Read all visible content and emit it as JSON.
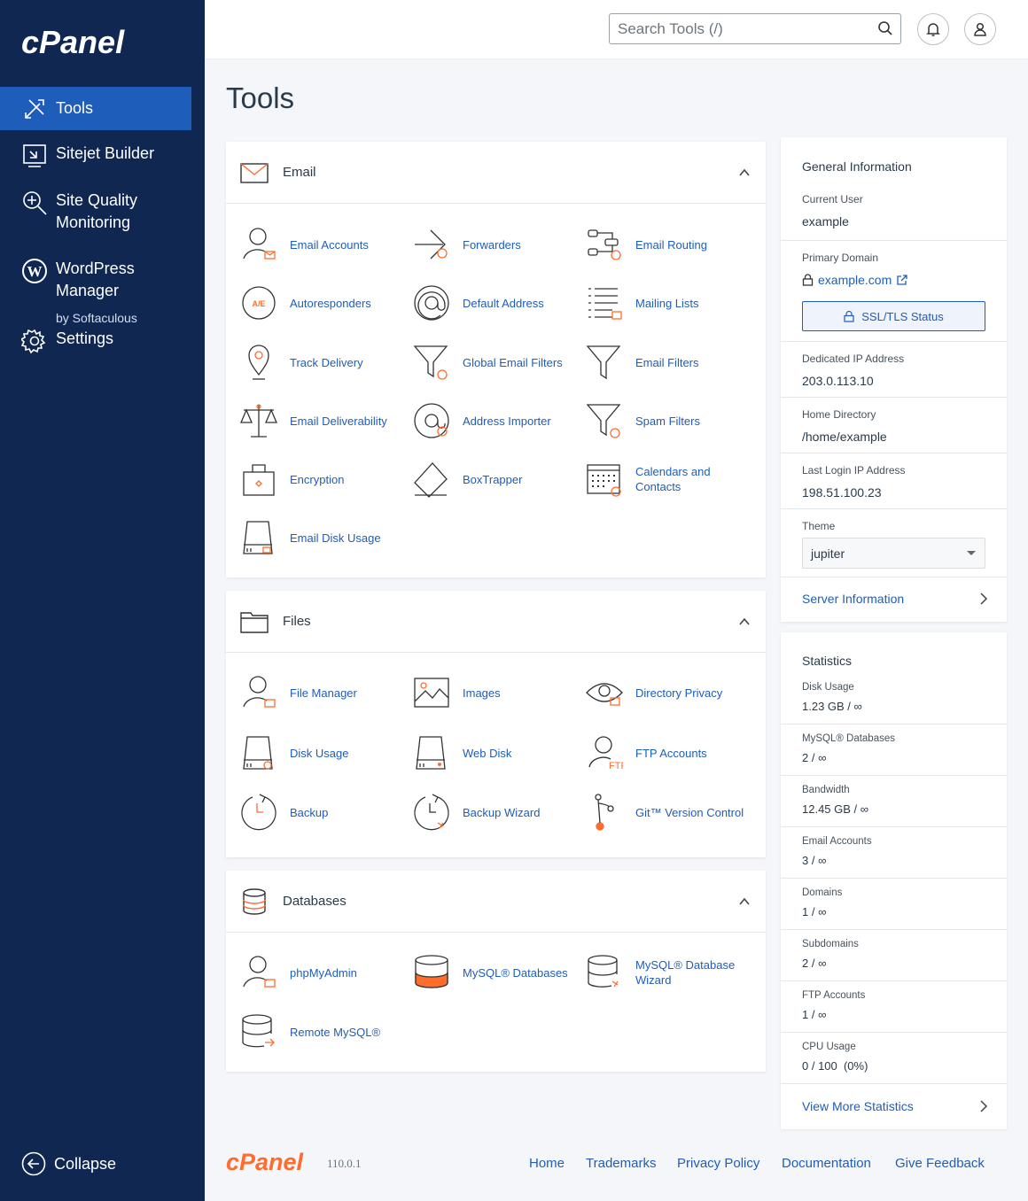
{
  "brand": {
    "logo_text": "cPanel",
    "orange": "#ff6c2c",
    "navy": "#0f2751",
    "blue": "#1f5dba"
  },
  "sidebar": {
    "items": [
      {
        "label": "Tools",
        "icon": "tools-icon",
        "active": true
      },
      {
        "label": "Sitejet Builder",
        "icon": "sitejet-icon"
      },
      {
        "label": "Site Quality Monitoring",
        "icon": "search-plus-icon"
      },
      {
        "label": "WordPress Manager",
        "sub": "by Softaculous",
        "icon": "wordpress-icon"
      },
      {
        "label": "Settings",
        "icon": "gear-icon"
      }
    ],
    "collapse": "Collapse"
  },
  "topbar": {
    "search_placeholder": "Search Tools (/)"
  },
  "page_title": "Tools",
  "sections": {
    "email": {
      "title": "Email",
      "items": [
        "Email Accounts",
        "Forwarders",
        "Email Routing",
        "Autoresponders",
        "Default Address",
        "Mailing Lists",
        "Track Delivery",
        "Global Email Filters",
        "Email Filters",
        "Email Deliverability",
        "Address Importer",
        "Spam Filters",
        "Encryption",
        "BoxTrapper",
        "Calendars and Contacts",
        "Email Disk Usage"
      ]
    },
    "files": {
      "title": "Files",
      "items": [
        "File Manager",
        "Images",
        "Directory Privacy",
        "Disk Usage",
        "Web Disk",
        "FTP Accounts",
        "Backup",
        "Backup Wizard",
        "Git™ Version Control"
      ]
    },
    "databases": {
      "title": "Databases",
      "items": [
        "phpMyAdmin",
        "MySQL® Databases",
        "MySQL® Database Wizard",
        "Remote MySQL®"
      ]
    }
  },
  "general": {
    "title": "General Information",
    "current_user_label": "Current User",
    "current_user": "example",
    "primary_domain_label": "Primary Domain",
    "primary_domain": "example.com",
    "ssl_button": "SSL/TLS Status",
    "dedicated_ip_label": "Dedicated IP Address",
    "dedicated_ip": "203.0.113.10",
    "home_dir_label": "Home Directory",
    "home_dir": "/home/example",
    "last_login_label": "Last Login IP Address",
    "last_login": "198.51.100.23",
    "theme_label": "Theme",
    "theme": "jupiter",
    "server_info": "Server Information"
  },
  "stats": {
    "title": "Statistics",
    "rows": [
      {
        "label": "Disk Usage",
        "value": "1.23 GB / ∞"
      },
      {
        "label": "MySQL® Databases",
        "value": "2 / ∞"
      },
      {
        "label": "Bandwidth",
        "value": "12.45 GB / ∞"
      },
      {
        "label": "Email Accounts",
        "value": "3 / ∞"
      },
      {
        "label": "Domains",
        "value": "1 / ∞"
      },
      {
        "label": "Subdomains",
        "value": "2 / ∞"
      },
      {
        "label": "FTP Accounts",
        "value": "1 / ∞"
      },
      {
        "label": "CPU Usage",
        "value": "0 / 100  (0%)"
      }
    ],
    "more": "View More Statistics"
  },
  "footer": {
    "logo_text": "cPanel",
    "version": "110.0.1",
    "links": [
      "Home",
      "Trademarks",
      "Privacy Policy",
      "Documentation",
      "Give Feedback"
    ]
  }
}
